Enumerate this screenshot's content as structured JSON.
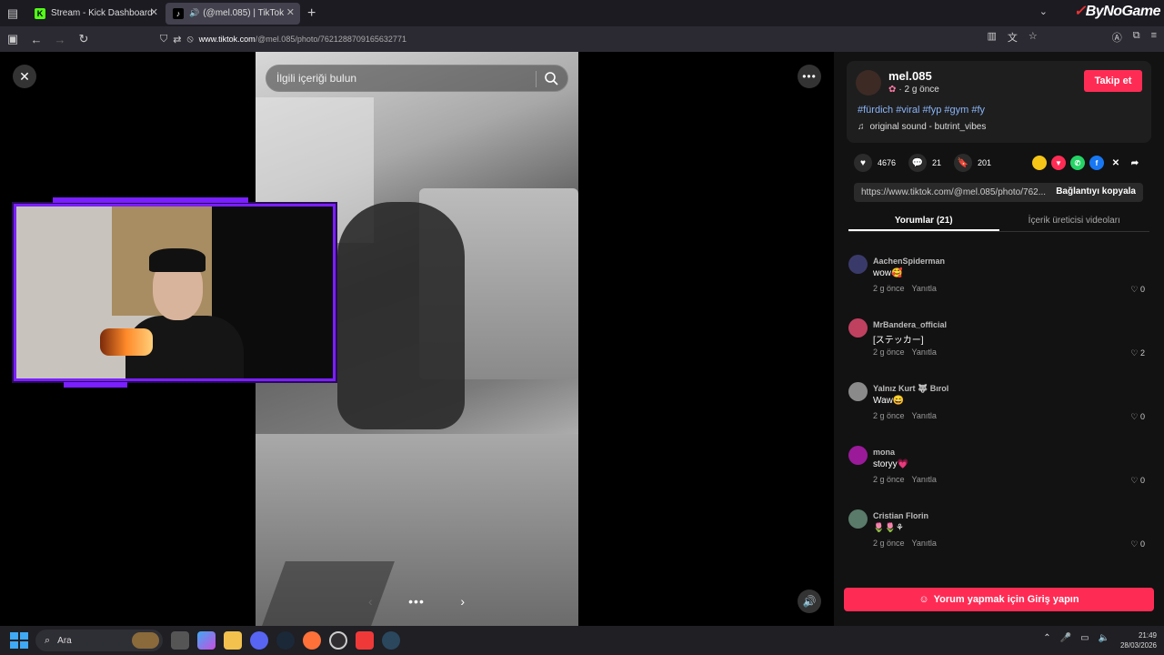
{
  "browser": {
    "tabs": [
      {
        "label": "Stream - Kick Dashboard",
        "active": false,
        "favicon": "kick-icon"
      },
      {
        "label": "(@mel.085) | TikTok",
        "active": true,
        "favicon": "tiktok-icon"
      }
    ],
    "brand": "ByNoGame",
    "url_host": "www.tiktok.com",
    "url_path": "/@mel.085/photo/7621288709165632771"
  },
  "viewer": {
    "search_placeholder": "İlgili içeriği bulun",
    "more_label": "•••",
    "carousel_dots": "•••"
  },
  "post": {
    "username": "mel.085",
    "posted": "· 2 g önce",
    "follow_label": "Takip et",
    "hashtags": "#fürdich #viral #fyp #gym #fy",
    "sound": "original sound - butrint_vibes",
    "likes": "4676",
    "comments_count": "21",
    "saves": "201",
    "link": "https://www.tiktok.com/@mel.085/photo/762...",
    "copy_link_label": "Bağlantıyı kopyala"
  },
  "panel_tabs": [
    {
      "label": "Yorumlar (21)",
      "active": true
    },
    {
      "label": "İçerik üreticisi videoları",
      "active": false
    }
  ],
  "comments": [
    {
      "user": "AachenSpiderman",
      "text": "wow🥰",
      "time": "2 g önce",
      "reply": "Yanıtla",
      "likes": "0",
      "avatar_color": "#3a3a6a"
    },
    {
      "user": "MrBandera_official",
      "text": "[ステッカー]",
      "time": "2 g önce",
      "reply": "Yanıtla",
      "likes": "2",
      "avatar_color": "#c04060"
    },
    {
      "user": "Yalnız Kurt 🐺 Bırol",
      "text": "Waw😄",
      "time": "2 g önce",
      "reply": "Yanıtla",
      "likes": "0",
      "avatar_color": "#8a8a8a"
    },
    {
      "user": "mona",
      "text": "storyy💗",
      "time": "2 g önce",
      "reply": "Yanıtla",
      "likes": "0",
      "avatar_color": "#9a1a9a"
    },
    {
      "user": "Cristian Florin",
      "text": "🌷🌷⚘",
      "time": "2 g önce",
      "reply": "Yanıtla",
      "likes": "0",
      "avatar_color": "#5a7a6a"
    }
  ],
  "login_label": "Yorum yapmak için Giriş yapın",
  "taskbar": {
    "search_label": "Ara",
    "time": "21:49",
    "date": "28/03/2026"
  },
  "colors": {
    "tiktok_red": "#fe2c55",
    "overlay_purple": "#7a1fff",
    "hashtag_blue": "#8ab4f8"
  }
}
